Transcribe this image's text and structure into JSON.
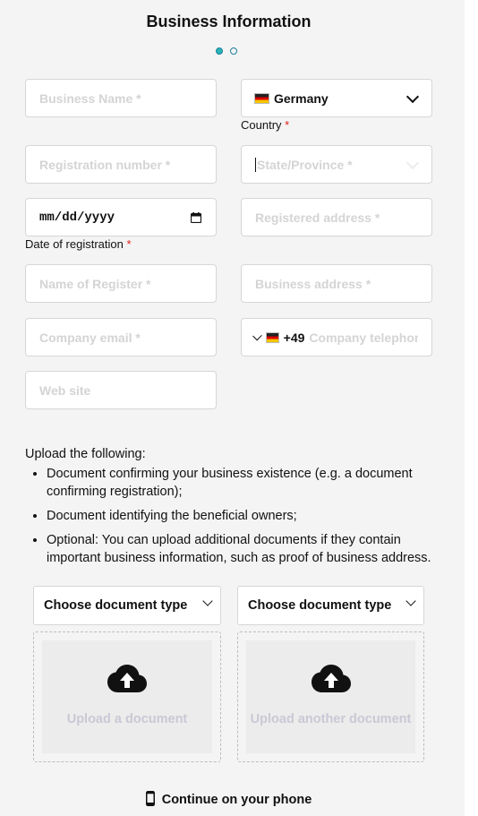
{
  "header": {
    "title": "Business Information",
    "steps": [
      {
        "active": true
      },
      {
        "active": false
      }
    ]
  },
  "form": {
    "business_name": {
      "placeholder": "Business Name *"
    },
    "country": {
      "value": "Germany",
      "label": "Country",
      "required_mark": "*",
      "flag": "germany-flag-icon"
    },
    "registration_number": {
      "placeholder": "Registration number *"
    },
    "state_province": {
      "placeholder": "State/Province *"
    },
    "date_of_registration": {
      "value": "mm/dd/yyyy",
      "label": "Date of registration",
      "required_mark": "*"
    },
    "registered_address": {
      "placeholder": "Registered address *"
    },
    "name_of_register": {
      "placeholder": "Name of Register *"
    },
    "business_address": {
      "placeholder": "Business address *"
    },
    "company_email": {
      "placeholder": "Company email *"
    },
    "company_telephone": {
      "dial_code": "+49",
      "placeholder": "Company telephone *"
    },
    "web_site": {
      "placeholder": "Web site"
    }
  },
  "upload": {
    "intro": "Upload the following:",
    "items": [
      "Document confirming your business existence (e.g. a document confirming registration);",
      "Document identifying the beneficial owners;",
      "Optional: You can upload additional documents if they contain important business information, such as proof of business address."
    ],
    "slots": [
      {
        "type_label": "Choose document type",
        "upload_label": "Upload a document"
      },
      {
        "type_label": "Choose document type",
        "upload_label": "Upload another document"
      }
    ]
  },
  "footer": {
    "phone_link": "Continue on your phone"
  },
  "colors": {
    "background": "#f4f4f4",
    "required": "#e02020",
    "step_active": "#27b5b5",
    "placeholder": "#d4d4d4"
  }
}
